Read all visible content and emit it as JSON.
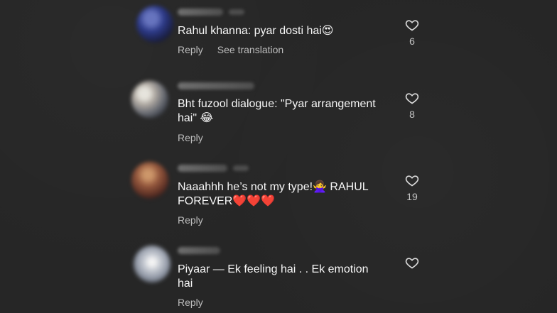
{
  "comments": [
    {
      "text": "Rahul khanna: pyar dosti hai😍",
      "actions": [
        "Reply",
        "See translation"
      ],
      "likes": "6",
      "avatar_color": "#2b2f6b",
      "username_width_hint": "wide"
    },
    {
      "text": "Bht fuzool dialogue: \"Pyar arrangement hai\" 😂",
      "actions": [
        "Reply"
      ],
      "likes": "8",
      "avatar_color": "#b7b0a8",
      "username_width_hint": "wide"
    },
    {
      "text": "Naaahhh he’s not my type!🙅‍♀️ RAHUL FOREVER❤️❤️❤️",
      "actions": [
        "Reply"
      ],
      "likes": "19",
      "avatar_color": "#9b5b3f",
      "username_width_hint": "medium"
    },
    {
      "text": "Piyaar — Ek feeling hai . . Ek emotion hai",
      "actions": [
        "Reply"
      ],
      "likes": "",
      "avatar_color": "#d7dbe2",
      "username_width_hint": "small"
    }
  ],
  "icons": {
    "like": "heart-outline-icon"
  },
  "colors": {
    "background": "#262626",
    "text": "#f5f5f5",
    "secondary_text": "#bdbdbd"
  }
}
